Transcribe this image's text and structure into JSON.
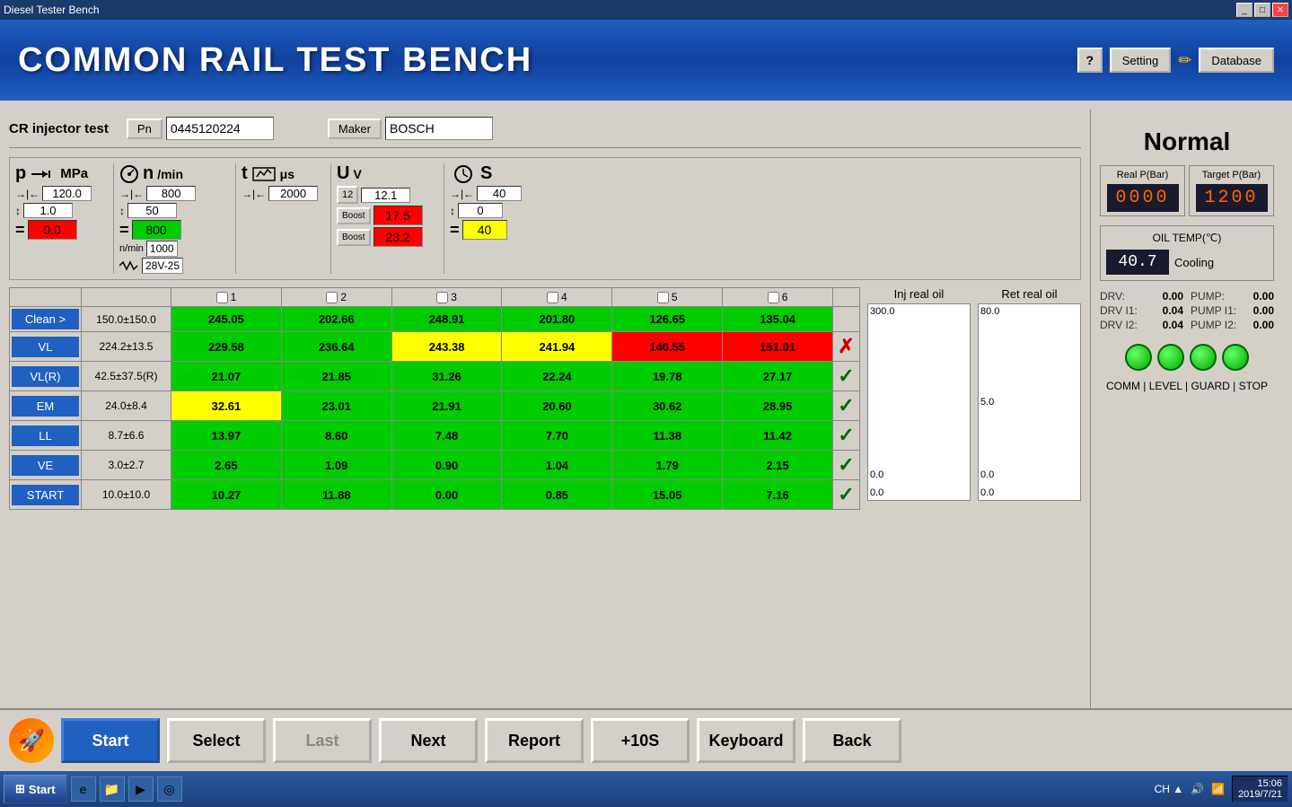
{
  "window": {
    "title": "Diesel Tester Bench"
  },
  "header": {
    "title": "COMMON RAIL TEST BENCH",
    "help_label": "?",
    "setting_label": "Setting",
    "pencil_icon": "✏",
    "database_label": "Database"
  },
  "info_bar": {
    "cr_label": "CR injector test",
    "pn_label": "Pn",
    "pn_value": "0445120224",
    "maker_label": "Maker",
    "maker_value": "BOSCH"
  },
  "measurements": [
    {
      "id": "pressure",
      "symbol": "p",
      "unit": "MPa",
      "arrow_right": "→|←",
      "val1": "120.0",
      "arrow_down": "↓↑",
      "val2": "1.0",
      "eq": "=",
      "val3": "0.0",
      "val3_color": "red"
    },
    {
      "id": "rpm",
      "symbol": "n",
      "unit": "/min",
      "arrow_right": "→|←",
      "val1": "800",
      "arrow_down": "↓↑",
      "val2": "50",
      "eq": "=",
      "val3": "800",
      "val3_color": "green",
      "extra1": "n/min",
      "extra1_val": "1000",
      "extra2": "~",
      "extra2_val": "28V-25"
    },
    {
      "id": "time",
      "symbol": "t",
      "unit": "μs",
      "arrow_right": "→|←",
      "val1": "2000",
      "arrow_down": "",
      "val2": "",
      "eq": "",
      "val3": ""
    },
    {
      "id": "voltage",
      "symbol": "U",
      "unit": "V",
      "arrow_right": "→|←",
      "val1": "12.1",
      "boost1": "17.5",
      "boost1_color": "red",
      "boost2": "23.2",
      "boost2_color": "red"
    },
    {
      "id": "time2",
      "symbol": "S",
      "unit": "S",
      "arrow_right": "→|←",
      "val1": "40",
      "arrow_down": "↓↑",
      "val2": "0",
      "eq": "=",
      "val3": "40",
      "val3_color": "yellow"
    }
  ],
  "table": {
    "columns": [
      "",
      "",
      "1",
      "2",
      "3",
      "4",
      "5",
      "6",
      ""
    ],
    "rows": [
      {
        "label": "Clean >",
        "range": "150.0±150.0",
        "c1": "245.05",
        "c1_color": "green",
        "c2": "202.66",
        "c2_color": "green",
        "c3": "248.91",
        "c3_color": "green",
        "c4": "201.80",
        "c4_color": "green",
        "c5": "126.65",
        "c5_color": "green",
        "c6": "135.04",
        "c6_color": "green",
        "status": ""
      },
      {
        "label": "VL",
        "range": "224.2±13.5",
        "c1": "229.58",
        "c1_color": "green",
        "c2": "236.64",
        "c2_color": "green",
        "c3": "243.38",
        "c3_color": "yellow",
        "c4": "241.94",
        "c4_color": "yellow",
        "c5": "140.55",
        "c5_color": "red",
        "c6": "151.01",
        "c6_color": "red",
        "status": "cross"
      },
      {
        "label": "VL(R)",
        "range": "42.5±37.5(R)",
        "c1": "21.07",
        "c1_color": "green",
        "c2": "21.85",
        "c2_color": "green",
        "c3": "31.26",
        "c3_color": "green",
        "c4": "22.24",
        "c4_color": "green",
        "c5": "19.78",
        "c5_color": "green",
        "c6": "27.17",
        "c6_color": "green",
        "status": "check"
      },
      {
        "label": "EM",
        "range": "24.0±8.4",
        "c1": "32.61",
        "c1_color": "yellow",
        "c2": "23.01",
        "c2_color": "green",
        "c3": "21.91",
        "c3_color": "green",
        "c4": "20.60",
        "c4_color": "green",
        "c5": "30.62",
        "c5_color": "green",
        "c6": "28.95",
        "c6_color": "green",
        "status": "check"
      },
      {
        "label": "LL",
        "range": "8.7±6.6",
        "c1": "13.97",
        "c1_color": "green",
        "c2": "8.60",
        "c2_color": "green",
        "c3": "7.48",
        "c3_color": "green",
        "c4": "7.70",
        "c4_color": "green",
        "c5": "11.38",
        "c5_color": "green",
        "c6": "11.42",
        "c6_color": "green",
        "status": "check"
      },
      {
        "label": "VE",
        "range": "3.0±2.7",
        "c1": "2.65",
        "c1_color": "green",
        "c2": "1.09",
        "c2_color": "green",
        "c3": "0.90",
        "c3_color": "green",
        "c4": "1.04",
        "c4_color": "green",
        "c5": "1.79",
        "c5_color": "green",
        "c6": "2.15",
        "c6_color": "green",
        "status": "check"
      },
      {
        "label": "START",
        "range": "10.0±10.0",
        "c1": "10.27",
        "c1_color": "green",
        "c2": "11.88",
        "c2_color": "green",
        "c3": "0.00",
        "c3_color": "green",
        "c4": "0.85",
        "c4_color": "green",
        "c5": "15.05",
        "c5_color": "green",
        "c6": "7.16",
        "c6_color": "green",
        "status": "check"
      }
    ]
  },
  "inj_chart": {
    "title": "Inj real oil",
    "y_top": "300.0",
    "y_mid": "",
    "y_bot": "0.0",
    "x_left": "0.0",
    "x_right": ""
  },
  "ret_chart": {
    "title": "Ret real oil",
    "y_top": "80.0",
    "y_mid": "5.0",
    "y_bot": "0.0",
    "x_left": "0.0",
    "x_right": ""
  },
  "right_panel": {
    "status": "Normal",
    "real_p_label": "Real P(Bar)",
    "target_p_label": "Target P(Bar)",
    "real_p_value": "0000",
    "target_p_value": "1200",
    "oil_temp_label": "OIL TEMP(℃)",
    "oil_temp_value": "40.7",
    "cooling_label": "Cooling",
    "drv": {
      "label": "DRV:",
      "value": "0.00"
    },
    "drv_i1": {
      "label": "DRV I1:",
      "value": "0.04"
    },
    "drv_i2": {
      "label": "DRV I2:",
      "value": "0.04"
    },
    "pump": {
      "label": "PUMP:",
      "value": "0.00"
    },
    "pump_i1": {
      "label": "PUMP I1:",
      "value": "0.00"
    },
    "pump_i2": {
      "label": "PUMP I2:",
      "value": "0.00"
    },
    "status_labels": "COMM | LEVEL | GUARD | STOP"
  },
  "toolbar": {
    "start_label": "Start",
    "select_label": "Select",
    "last_label": "Last",
    "next_label": "Next",
    "report_label": "Report",
    "plus10s_label": "+10S",
    "keyboard_label": "Keyboard",
    "back_label": "Back"
  },
  "taskbar": {
    "start_label": "Start",
    "time": "15:06",
    "date": "2019/7/21",
    "ch_label": "CH ▲"
  }
}
